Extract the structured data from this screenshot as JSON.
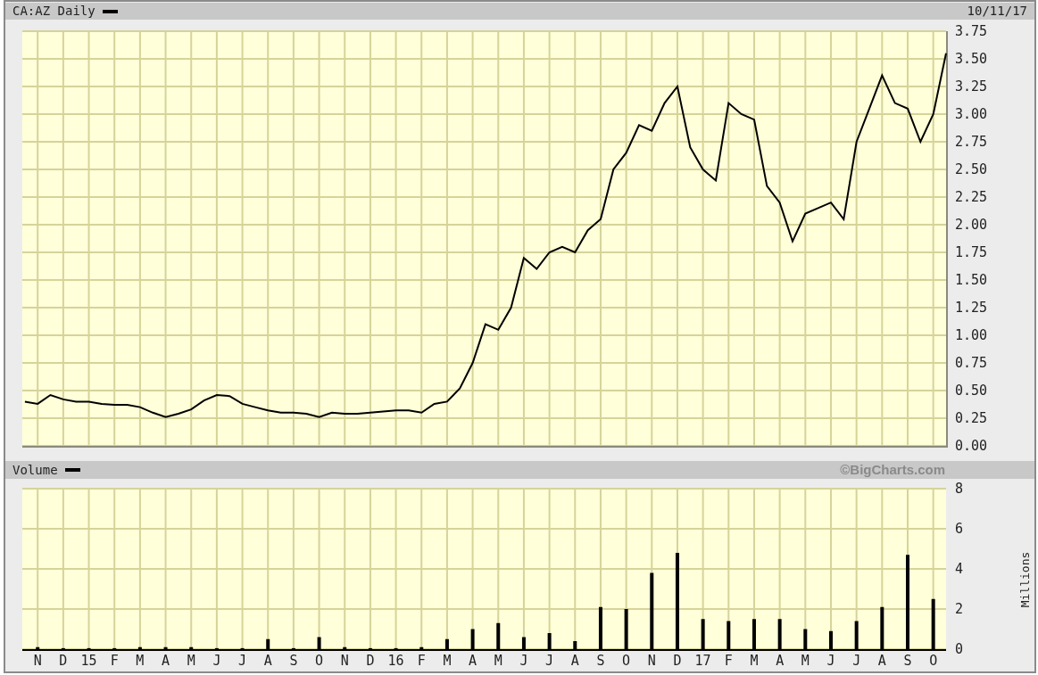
{
  "header": {
    "date": "10/11/17"
  },
  "price_panel": {
    "chart_data": {
      "type": "line",
      "grid": true,
      "ylim": [
        0,
        3.75
      ],
      "yticks": [
        {
          "value": 3.75,
          "label": "3.75"
        },
        {
          "value": 3.5,
          "label": "3.50"
        },
        {
          "value": 3.25,
          "label": "3.25"
        },
        {
          "value": 3,
          "label": "3.00"
        },
        {
          "value": 2.75,
          "label": "2.75"
        },
        {
          "value": 2.5,
          "label": "2.50"
        },
        {
          "value": 2.25,
          "label": "2.25"
        },
        {
          "value": 2,
          "label": "2.00"
        },
        {
          "value": 1.75,
          "label": "1.75"
        },
        {
          "value": 1.5,
          "label": "1.50"
        },
        {
          "value": 1.25,
          "label": "1.25"
        },
        {
          "value": 1,
          "label": "1.00"
        },
        {
          "value": 0.75,
          "label": "0.75"
        },
        {
          "value": 0.5,
          "label": "0.50"
        },
        {
          "value": 0.25,
          "label": "0.25"
        },
        {
          "value": 0,
          "label": "0.00"
        }
      ],
      "series": [
        {
          "name": "CA:AZ Daily",
          "color": "#000000",
          "values": [
            0.4,
            0.38,
            0.46,
            0.42,
            0.4,
            0.4,
            0.38,
            0.37,
            0.37,
            0.35,
            0.3,
            0.26,
            0.29,
            0.33,
            0.41,
            0.46,
            0.45,
            0.38,
            0.35,
            0.32,
            0.3,
            0.3,
            0.29,
            0.26,
            0.3,
            0.29,
            0.29,
            0.3,
            0.31,
            0.32,
            0.32,
            0.3,
            0.38,
            0.4,
            0.52,
            0.75,
            1.1,
            1.05,
            1.25,
            1.7,
            1.6,
            1.75,
            1.8,
            1.75,
            1.95,
            2.05,
            2.5,
            2.65,
            2.9,
            2.85,
            3.1,
            3.25,
            2.7,
            2.5,
            2.4,
            3.1,
            3.0,
            2.95,
            2.35,
            2.2,
            1.85,
            2.1,
            2.15,
            2.2,
            2.05,
            2.75,
            3.05,
            3.35,
            3.1,
            3.05,
            2.75,
            3.0,
            3.55
          ]
        }
      ]
    }
  },
  "volume_panel": {
    "credit": "©BigCharts.com",
    "chart_data": {
      "type": "bar",
      "grid": true,
      "ylabel": "Millions",
      "ylim": [
        0,
        8
      ],
      "yticks": [
        0,
        2,
        4,
        6,
        8
      ],
      "categories": [
        "N",
        "D",
        "15",
        "F",
        "M",
        "A",
        "M",
        "J",
        "J",
        "A",
        "S",
        "O",
        "N",
        "D",
        "16",
        "F",
        "M",
        "A",
        "M",
        "J",
        "J",
        "A",
        "S",
        "O",
        "N",
        "D",
        "17",
        "F",
        "M",
        "A",
        "M",
        "J",
        "J",
        "A",
        "S",
        "O"
      ],
      "series": [
        {
          "name": "Volume",
          "color": "#000000",
          "values": [
            0.1,
            0.05,
            0.05,
            0.05,
            0.1,
            0.1,
            0.1,
            0.05,
            0.05,
            0.5,
            0.05,
            0.6,
            0.1,
            0.05,
            0.05,
            0.1,
            0.5,
            1.0,
            1.3,
            0.6,
            0.8,
            0.4,
            2.1,
            2.0,
            3.8,
            4.8,
            1.5,
            1.4,
            1.5,
            1.5,
            1.0,
            0.9,
            1.4,
            2.1,
            4.7,
            2.5
          ]
        }
      ]
    }
  }
}
